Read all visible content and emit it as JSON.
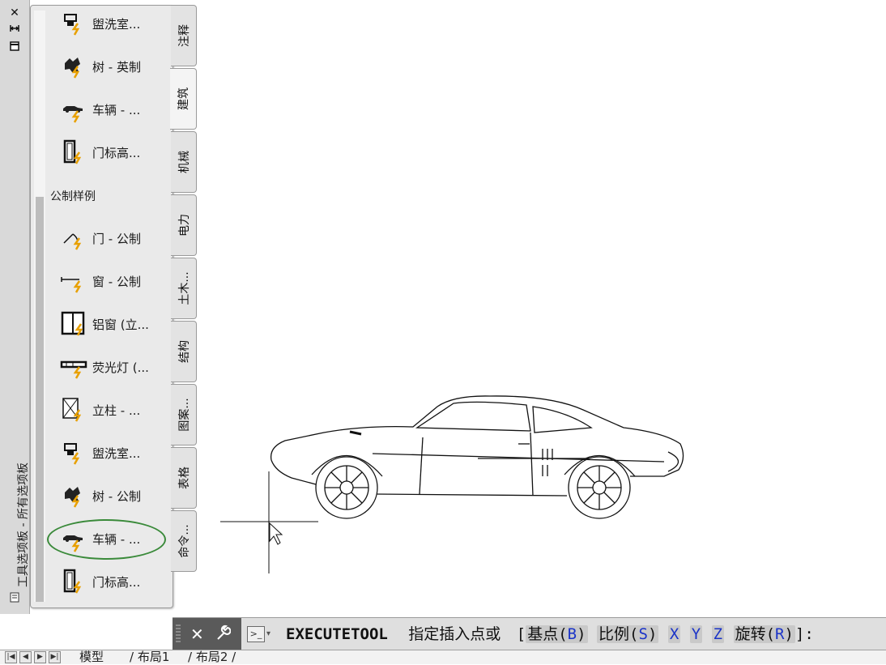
{
  "palette": {
    "title": "工具选项板 - 所有选项板",
    "close_glyph": "✕",
    "items": [
      {
        "label": "盥洗室...",
        "icon": "washroom-block-icon"
      },
      {
        "label": "树 - 英制",
        "icon": "tree-block-icon"
      },
      {
        "label": "车辆 - ...",
        "icon": "vehicle-block-icon"
      },
      {
        "label": "门标高...",
        "icon": "door-elevation-block-icon"
      },
      {
        "label": "门 - 公制",
        "icon": "door-block-icon"
      },
      {
        "label": "窗 - 公制",
        "icon": "window-block-icon"
      },
      {
        "label": "铝窗 (立...",
        "icon": "aluminum-window-block-icon"
      },
      {
        "label": "荧光灯 (...",
        "icon": "fluorescent-light-block-icon"
      },
      {
        "label": "立柱 - ...",
        "icon": "column-block-icon"
      },
      {
        "label": "盥洗室...",
        "icon": "washroom-block-icon"
      },
      {
        "label": "树 - 公制",
        "icon": "tree-block-icon"
      },
      {
        "label": "车辆 - ...",
        "icon": "vehicle-block-icon"
      },
      {
        "label": "门标高...",
        "icon": "door-elevation-block-icon"
      }
    ],
    "section_header": "公制样例",
    "tabs": [
      "注释",
      "建筑",
      "机械",
      "电力",
      "土木...",
      "结构",
      "图案...",
      "表格",
      "命令..."
    ],
    "active_tab": "建筑"
  },
  "command": {
    "close_glyph": "✕",
    "wrench_glyph": "🔧",
    "prompt_glyph": ">_",
    "dropdown_glyph": "▾",
    "command_name": "EXECUTETOOL",
    "prompt": "指定插入点或",
    "open_bracket": "[",
    "options": [
      {
        "text": "基点(",
        "key": "B",
        "close": ")"
      },
      {
        "text": "比例(",
        "key": "S",
        "close": ")"
      },
      {
        "text": "",
        "key": "X",
        "close": ""
      },
      {
        "text": "",
        "key": "Y",
        "close": ""
      },
      {
        "text": "",
        "key": "Z",
        "close": ""
      },
      {
        "text": "旋转(",
        "key": "R",
        "close": ")"
      }
    ],
    "close_bracket": "]:"
  },
  "layout_tabs": [
    "模型",
    "布局1",
    "布局2"
  ],
  "colors": {
    "highlight_ring": "#3a8a3a",
    "option_key": "#1a33c8",
    "block_lightning": "#e8a000"
  }
}
